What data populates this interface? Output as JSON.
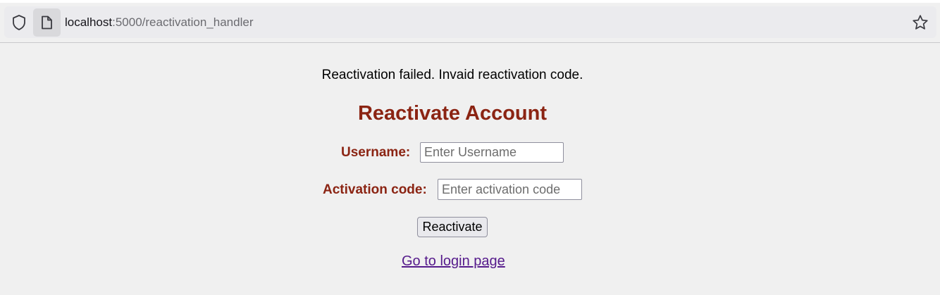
{
  "browser": {
    "url_host": "localhost",
    "url_path": ":5000/reactivation_handler",
    "icons": [
      "shield-icon",
      "page-icon",
      "star-icon"
    ]
  },
  "page": {
    "message": "Reactivation failed. Invaid reactivation code.",
    "title": "Reactivate Account",
    "username_label": "Username:",
    "username_placeholder": "Enter Username",
    "activation_label": "Activation code:",
    "activation_placeholder": "Enter activation code",
    "submit_label": "Reactivate",
    "login_link": "Go to login page"
  },
  "colors": {
    "accent": "#8b2413",
    "link": "#551a8b",
    "background": "#f0f0f0"
  }
}
